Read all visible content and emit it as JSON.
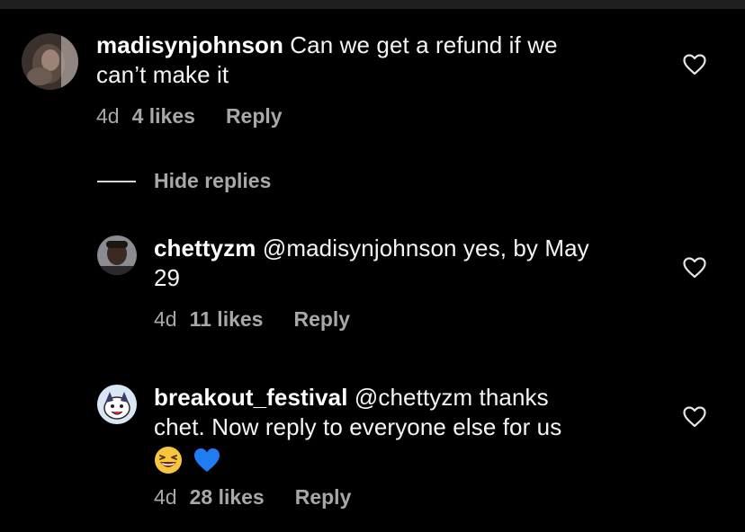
{
  "comments": [
    {
      "username": "madisynjohnson",
      "text_line1": " Can we get a refund if we",
      "text_line2": "can’t make it",
      "time": "4d",
      "likes": "4 likes",
      "reply": "Reply"
    },
    {
      "username": "chettyzm",
      "text_line1": " @madisynjohnson yes, by May",
      "text_line2": "29",
      "time": "4d",
      "likes": "11 likes",
      "reply": "Reply"
    },
    {
      "username": "breakout_festival",
      "text_line1": " @chettyzm thanks",
      "text_line2": "chet. Now reply to everyone else for us",
      "emojis": [
        "laughing-face-emoji",
        "blue-heart-emoji"
      ],
      "time": "4d",
      "likes": "28 likes",
      "reply": "Reply"
    }
  ],
  "hide_replies_label": "Hide replies",
  "colors": {
    "background": "#000000",
    "text": "#f5f5f5",
    "meta": "#a8a8a8",
    "blue_heart": "#1f7cf2"
  }
}
